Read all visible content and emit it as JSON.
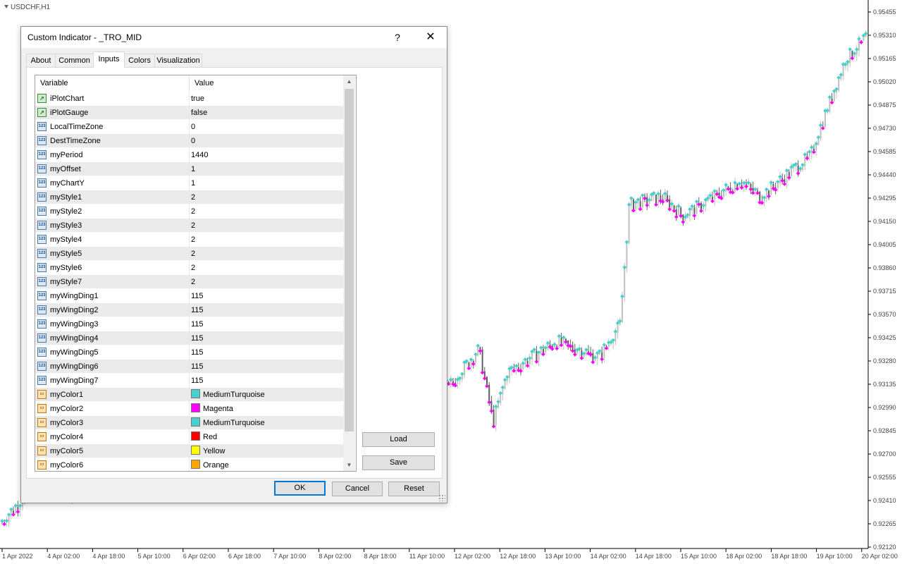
{
  "chart": {
    "symbol": "USDCHF,H1",
    "price_axis": [
      "0.95455",
      "0.95310",
      "0.95165",
      "0.95020",
      "0.94875",
      "0.94730",
      "0.94585",
      "0.94440",
      "0.94295",
      "0.94150",
      "0.94005",
      "0.93860",
      "0.93715",
      "0.93570",
      "0.93425",
      "0.93280",
      "0.93135",
      "0.92990",
      "0.92845",
      "0.92700",
      "0.92555",
      "0.92410",
      "0.92265",
      "0.92120"
    ],
    "time_axis": [
      "1 Apr 2022",
      "4 Apr 02:00",
      "4 Apr 18:00",
      "5 Apr 10:00",
      "6 Apr 02:00",
      "6 Apr 18:00",
      "7 Apr 10:00",
      "8 Apr 02:00",
      "8 Apr 18:00",
      "11 Apr 10:00",
      "12 Apr 02:00",
      "12 Apr 18:00",
      "13 Apr 10:00",
      "14 Apr 02:00",
      "14 Apr 18:00",
      "15 Apr 10:00",
      "18 Apr 02:00",
      "18 Apr 18:00",
      "19 Apr 10:00",
      "20 Apr 02:00"
    ],
    "colors": {
      "up_marker": "#48d1cc",
      "down_marker": "#ff00ff",
      "bull_bar": "#c0c0c0",
      "bear_bar": "#606060"
    }
  },
  "dialog": {
    "title": "Custom Indicator - _TRO_MID",
    "help": "?",
    "close": "✕",
    "tabs": [
      "About",
      "Common",
      "Inputs",
      "Colors",
      "Visualization"
    ],
    "active_tab": "Inputs",
    "columns": {
      "variable": "Variable",
      "value": "Value"
    },
    "rows": [
      {
        "icon": "bool",
        "variable": "iPlotChart",
        "value": "true"
      },
      {
        "icon": "bool",
        "variable": "iPlotGauge",
        "value": "false"
      },
      {
        "icon": "int",
        "variable": "LocalTimeZone",
        "value": "0"
      },
      {
        "icon": "int",
        "variable": "DestTimeZone",
        "value": "0"
      },
      {
        "icon": "int",
        "variable": "myPeriod",
        "value": "1440"
      },
      {
        "icon": "int",
        "variable": "myOffset",
        "value": "1"
      },
      {
        "icon": "int",
        "variable": "myChartY",
        "value": "1"
      },
      {
        "icon": "int",
        "variable": "myStyle1",
        "value": "2"
      },
      {
        "icon": "int",
        "variable": "myStyle2",
        "value": "2"
      },
      {
        "icon": "int",
        "variable": "myStyle3",
        "value": "2"
      },
      {
        "icon": "int",
        "variable": "myStyle4",
        "value": "2"
      },
      {
        "icon": "int",
        "variable": "myStyle5",
        "value": "2"
      },
      {
        "icon": "int",
        "variable": "myStyle6",
        "value": "2"
      },
      {
        "icon": "int",
        "variable": "myStyle7",
        "value": "2"
      },
      {
        "icon": "int",
        "variable": "myWingDing1",
        "value": "115"
      },
      {
        "icon": "int",
        "variable": "myWingDing2",
        "value": "115"
      },
      {
        "icon": "int",
        "variable": "myWingDing3",
        "value": "115"
      },
      {
        "icon": "int",
        "variable": "myWingDing4",
        "value": "115"
      },
      {
        "icon": "int",
        "variable": "myWingDing5",
        "value": "115"
      },
      {
        "icon": "int",
        "variable": "myWingDing6",
        "value": "115"
      },
      {
        "icon": "int",
        "variable": "myWingDing7",
        "value": "115"
      },
      {
        "icon": "color",
        "variable": "myColor1",
        "value": "MediumTurquoise",
        "swatch": "#48d1cc"
      },
      {
        "icon": "color",
        "variable": "myColor2",
        "value": "Magenta",
        "swatch": "#ff00ff"
      },
      {
        "icon": "color",
        "variable": "myColor3",
        "value": "MediumTurquoise",
        "swatch": "#48d1cc"
      },
      {
        "icon": "color",
        "variable": "myColor4",
        "value": "Red",
        "swatch": "#ff0000"
      },
      {
        "icon": "color",
        "variable": "myColor5",
        "value": "Yellow",
        "swatch": "#ffff00"
      },
      {
        "icon": "color",
        "variable": "myColor6",
        "value": "Orange",
        "swatch": "#ffa500"
      }
    ],
    "side_buttons": {
      "load": "Load",
      "save": "Save"
    },
    "footer_buttons": {
      "ok": "OK",
      "cancel": "Cancel",
      "reset": "Reset"
    }
  }
}
